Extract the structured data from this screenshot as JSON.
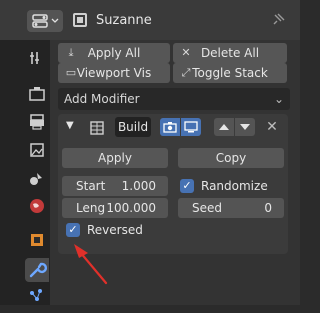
{
  "header": {
    "object_name": "Suzanne"
  },
  "toolbar": {
    "apply_all": "Apply All",
    "delete_all": "Delete All",
    "viewport_vis": "Viewport Vis",
    "toggle_stack": "Toggle Stack"
  },
  "add_modifier": {
    "label": "Add Modifier"
  },
  "modifier": {
    "name": "Build",
    "apply_label": "Apply",
    "copy_label": "Copy",
    "start_label": "Start",
    "start_value": "1.000",
    "length_label": "Leng",
    "length_value": "100.000",
    "randomize_label": "Randomize",
    "randomize_checked": true,
    "seed_label": "Seed",
    "seed_value": "0",
    "reversed_label": "Reversed",
    "reversed_checked": true
  },
  "colors": {
    "accent_blue": "#4772b3",
    "arrow_red": "#e0302a",
    "active_tab_icon": "#6ea8ff"
  },
  "icons": [
    "editor-type-icon",
    "object-icon",
    "pin-icon",
    "tool-icon",
    "render-icon",
    "output-icon",
    "view-layer-icon",
    "scene-icon",
    "world-icon",
    "object-tab-icon",
    "wrench-icon",
    "particles-icon"
  ]
}
